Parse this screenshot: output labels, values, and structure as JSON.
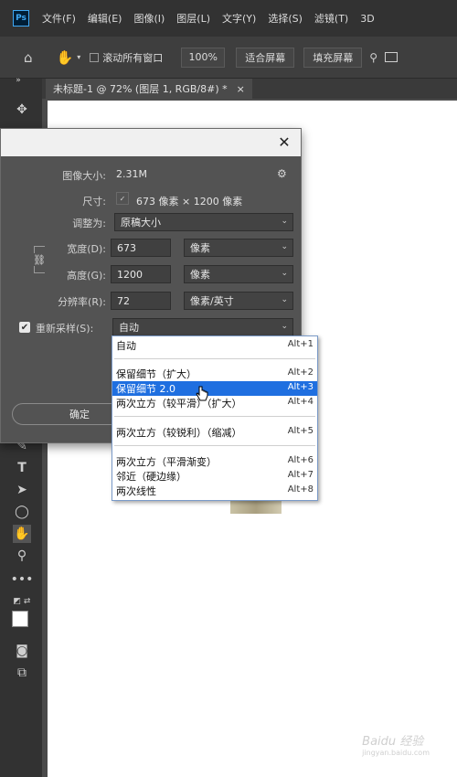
{
  "menubar": {
    "logo": "Ps",
    "items": [
      "文件(F)",
      "编辑(E)",
      "图像(I)",
      "图层(L)",
      "文字(Y)",
      "选择(S)",
      "滤镜(T)",
      "3D"
    ]
  },
  "options": {
    "scroll_all_label": "滚动所有窗口",
    "zoom": "100%",
    "fit_screen": "适合屏幕",
    "fill_screen": "填充屏幕"
  },
  "tab": {
    "title": "未标题-1 @ 72% (图层 1, RGB/8#) *",
    "close": "×"
  },
  "dialog": {
    "close": "✕",
    "image_size_label": "图像大小:",
    "image_size_value": "2.31M",
    "dimensions_label": "尺寸:",
    "dimensions_value": "673 像素 × 1200 像素",
    "fit_to_label": "调整为:",
    "fit_to_value": "原稿大小",
    "width_label": "宽度(D):",
    "width_value": "673",
    "width_unit": "像素",
    "height_label": "高度(G):",
    "height_value": "1200",
    "height_unit": "像素",
    "resolution_label": "分辨率(R):",
    "resolution_value": "72",
    "resolution_unit": "像素/英寸",
    "resample_label": "重新采样(S):",
    "resample_value": "自动",
    "ok_label": "确定"
  },
  "dropdown": {
    "items": [
      {
        "label": "自动",
        "shortcut": "Alt+1"
      },
      {
        "label": "保留细节（扩大）",
        "shortcut": "Alt+2"
      },
      {
        "label": "保留细节 2.0",
        "shortcut": "Alt+3"
      },
      {
        "label": "两次立方（较平滑）（扩大）",
        "shortcut": "Alt+4"
      },
      {
        "label": "两次立方（较锐利）（缩减）",
        "shortcut": "Alt+5"
      },
      {
        "label": "两次立方（平滑渐变）",
        "shortcut": "Alt+6"
      },
      {
        "label": "邻近（硬边缘）",
        "shortcut": "Alt+7"
      },
      {
        "label": "两次线性",
        "shortcut": "Alt+8"
      }
    ]
  },
  "watermark": {
    "text": "Baidu 经验",
    "url": "jingyan.baidu.com"
  }
}
